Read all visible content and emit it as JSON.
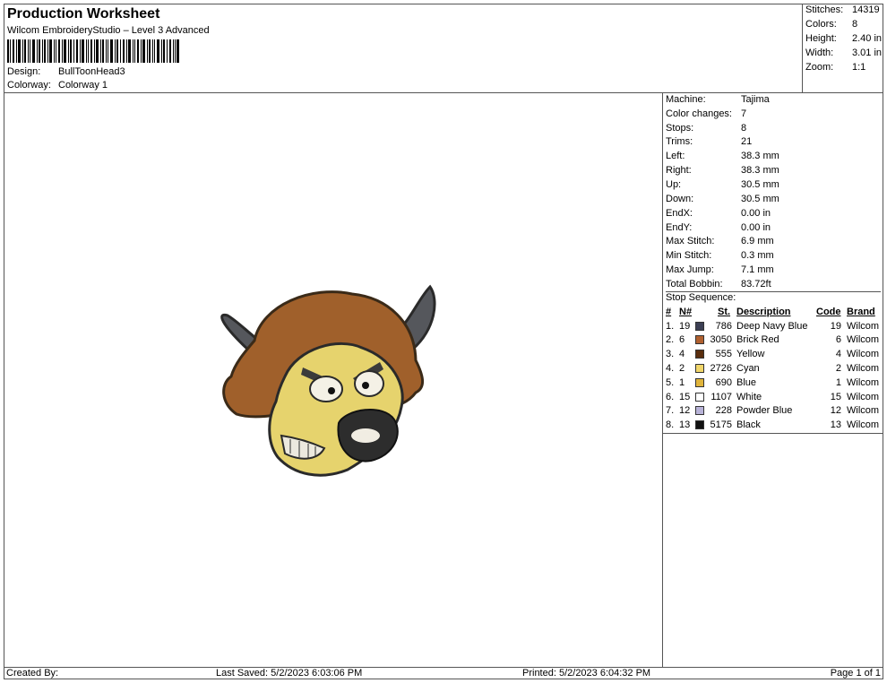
{
  "header": {
    "title": "Production Worksheet",
    "software": "Wilcom EmbroideryStudio – Level 3 Advanced",
    "design_label": "Design:",
    "design_value": "BullToonHead3",
    "colorway_label": "Colorway:",
    "colorway_value": "Colorway 1"
  },
  "stats": [
    {
      "label": "Stitches:",
      "value": "14319"
    },
    {
      "label": "Colors:",
      "value": "8"
    },
    {
      "label": "Height:",
      "value": "2.40 in"
    },
    {
      "label": "Width:",
      "value": "3.01 in"
    },
    {
      "label": "Zoom:",
      "value": "1:1"
    }
  ],
  "machine_info": [
    {
      "label": "Machine:",
      "value": "Tajima"
    },
    {
      "label": "Color changes:",
      "value": "7"
    },
    {
      "label": "Stops:",
      "value": "8"
    },
    {
      "label": "Trims:",
      "value": "21"
    },
    {
      "label": "Left:",
      "value": "38.3 mm"
    },
    {
      "label": "Right:",
      "value": "38.3 mm"
    },
    {
      "label": "Up:",
      "value": "30.5 mm"
    },
    {
      "label": "Down:",
      "value": "30.5 mm"
    },
    {
      "label": "EndX:",
      "value": "0.00 in"
    },
    {
      "label": "EndY:",
      "value": "0.00 in"
    },
    {
      "label": "Max Stitch:",
      "value": "6.9 mm"
    },
    {
      "label": "Min Stitch:",
      "value": "0.3 mm"
    },
    {
      "label": "Max Jump:",
      "value": "7.1 mm"
    },
    {
      "label": "Total Bobbin:",
      "value": "83.72ft"
    }
  ],
  "stop_sequence": {
    "title": "Stop Sequence:",
    "columns": {
      "num": "#",
      "n": "N#",
      "st": "St.",
      "description": "Description",
      "code": "Code",
      "brand": "Brand"
    },
    "rows": [
      {
        "num": "1.",
        "n": "19",
        "st": "786",
        "color": "#3c3f54",
        "description": "Deep Navy Blue",
        "code": "19",
        "brand": "Wilcom"
      },
      {
        "num": "2.",
        "n": "6",
        "st": "3050",
        "color": "#b0602f",
        "description": "Brick Red",
        "code": "6",
        "brand": "Wilcom"
      },
      {
        "num": "3.",
        "n": "4",
        "st": "555",
        "color": "#5a2e0e",
        "description": "Yellow",
        "code": "4",
        "brand": "Wilcom"
      },
      {
        "num": "4.",
        "n": "2",
        "st": "2726",
        "color": "#f1d66a",
        "description": "Cyan",
        "code": "2",
        "brand": "Wilcom"
      },
      {
        "num": "5.",
        "n": "1",
        "st": "690",
        "color": "#e0b43b",
        "description": "Blue",
        "code": "1",
        "brand": "Wilcom"
      },
      {
        "num": "6.",
        "n": "15",
        "st": "1107",
        "color": "#ffffff",
        "description": "White",
        "code": "15",
        "brand": "Wilcom"
      },
      {
        "num": "7.",
        "n": "12",
        "st": "228",
        "color": "#b8b3d8",
        "description": "Powder Blue",
        "code": "12",
        "brand": "Wilcom"
      },
      {
        "num": "8.",
        "n": "13",
        "st": "5175",
        "color": "#111111",
        "description": "Black",
        "code": "13",
        "brand": "Wilcom"
      }
    ]
  },
  "footer": {
    "created_by": "Created By:",
    "last_saved": "Last Saved: 5/2/2023 6:03:06 PM",
    "printed": "Printed: 5/2/2023 6:04:32 PM",
    "page": "Page 1 of 1"
  }
}
